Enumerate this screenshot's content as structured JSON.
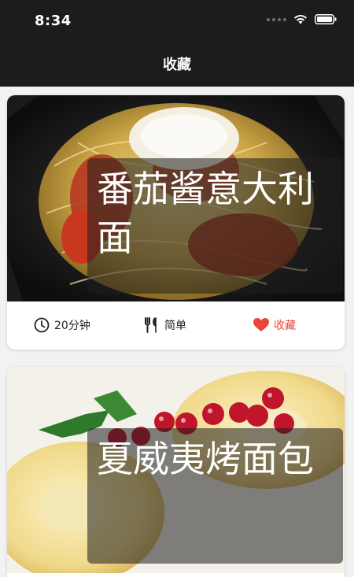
{
  "status": {
    "time": "8:34"
  },
  "nav": {
    "title": "收藏"
  },
  "recipes": [
    {
      "title": "番茄酱意大利面",
      "time": "20分钟",
      "difficulty": "简单",
      "favorite_label": "收藏"
    },
    {
      "title": "夏威夷烤面包"
    }
  ],
  "colors": {
    "topbar": "#1c1c1e",
    "favorite": "#e8453c",
    "background": "#f2f2f2"
  },
  "icons": {
    "time": "clock-icon",
    "difficulty": "utensils-icon",
    "favorite": "heart-icon"
  }
}
